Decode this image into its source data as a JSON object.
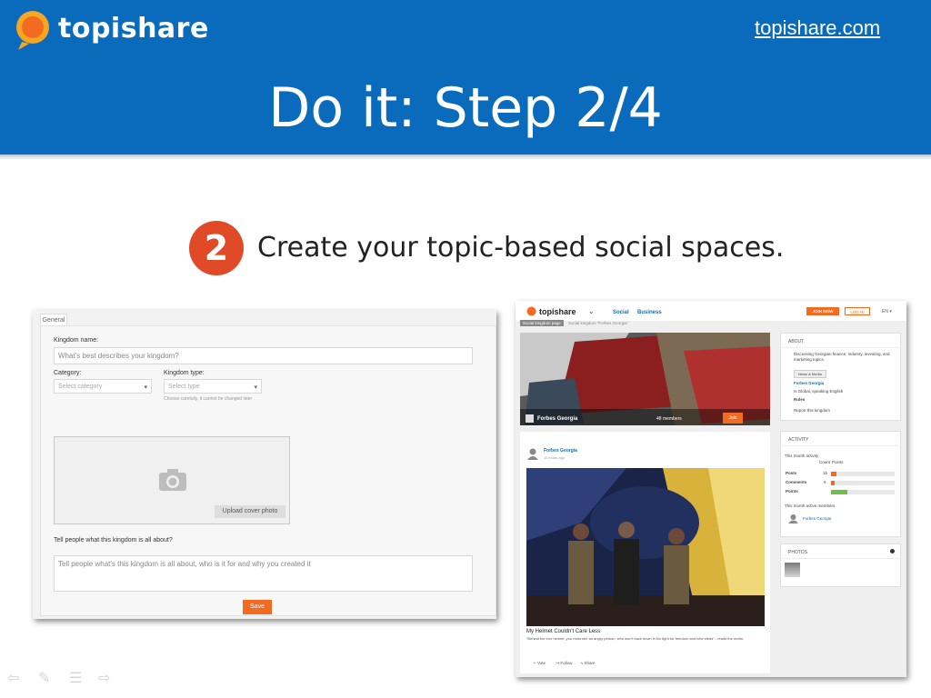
{
  "header": {
    "brand": "topishare",
    "site_link": "topishare.com",
    "title": "Do it: Step 2/4"
  },
  "step": {
    "number": "2",
    "text": "Create your topic-based social spaces."
  },
  "form": {
    "tab": "General",
    "kingdom_name_label": "Kingdom name:",
    "kingdom_name_placeholder": "What's best describes your kingdom?",
    "category_label": "Category:",
    "category_placeholder": "Select category",
    "type_label": "Kingdom type:",
    "type_placeholder": "Select type",
    "type_hint": "Choose carefully, it cannot be changed later",
    "upload_label": "Upload cover photo",
    "about_label": "Tell people what this kingdom is all about?",
    "about_placeholder": "Tell people what's this kingdom is all about, who is it for and why you created it",
    "save": "Save"
  },
  "kingdom_page": {
    "brand": "topishare",
    "nav": [
      "Social",
      "Business"
    ],
    "join_now": "JOIN NOW",
    "login": "LOG IN",
    "lang": "EN",
    "breadcrumb_active": "Social kingdom page",
    "breadcrumb_current": "Social kingdom \"Forbes Georgia\"",
    "banner_name": "Forbes Georgia",
    "banner_members": "48 members",
    "banner_join": "Join",
    "post": {
      "author": "Forbes Georgia",
      "time": "11 hours ago",
      "title": "My Helmet Couldn't Care Less",
      "quote": "\"Behind the iron helmet, you must see an angry person, who won't back down in his fight for freedom and new ideas\" - reads the motto.",
      "actions": [
        "Vote",
        "Follow",
        "Share"
      ]
    },
    "about": {
      "heading": "ABOUT",
      "description": "Discussing Georgian finance, industry, investing, and marketing topics.",
      "tag": "News & Media",
      "owner": "Forbes Georgia",
      "visibility": "Is Global, speaking English",
      "rules": "Rules",
      "report": "Report this kingdom"
    },
    "activity": {
      "heading": "ACTIVITY",
      "subheading": "This month activity",
      "columns": [
        "Count",
        "Points"
      ],
      "rows": [
        {
          "label": "Posts",
          "count": "15",
          "fill": 0.08
        },
        {
          "label": "Comments",
          "count": "5",
          "fill": 0.06
        },
        {
          "label": "Points",
          "count": "",
          "fill": 0.25
        }
      ],
      "active_members_label": "This month active members",
      "member": "Forbes Georgia"
    },
    "photos": {
      "heading": "PHOTOS"
    }
  },
  "colors": {
    "header_blue": "#0a6bbd",
    "accent_orange": "#f26b21",
    "step_red": "#e14a26"
  }
}
